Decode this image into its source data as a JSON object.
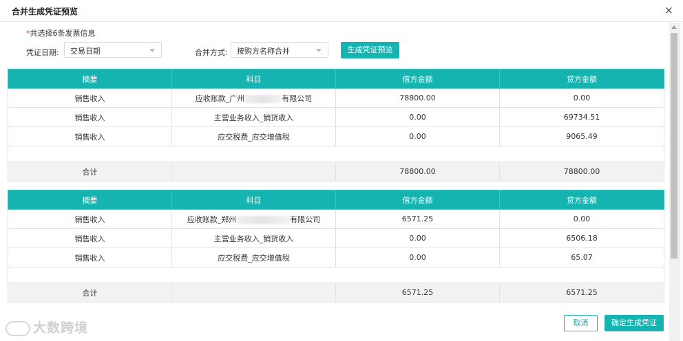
{
  "dialog": {
    "title": "合并生成凭证预览",
    "close_icon": "×"
  },
  "hint": {
    "star": "*",
    "text": "共选择6条发票信息"
  },
  "form": {
    "date_label": "凭证日期:",
    "date_value": "交易日期",
    "merge_label": "合并方式:",
    "merge_value": "按购方名称合并",
    "generate_button": "生成凭证预览"
  },
  "columns": [
    "摘要",
    "科目",
    "借方金额",
    "贷方金额"
  ],
  "vouchers": [
    {
      "rows": [
        {
          "summary": "销售收入",
          "subject_pre": "应收账款_广州",
          "subject_post": "有限公司",
          "debit": "78800.00",
          "credit": "0.00"
        },
        {
          "summary": "销售收入",
          "subject_pre": "主营业务收入_销货收入",
          "subject_post": "",
          "debit": "0.00",
          "credit": "69734.51"
        },
        {
          "summary": "销售收入",
          "subject_pre": "应交税费_应交增值税",
          "subject_post": "",
          "debit": "0.00",
          "credit": "9065.49"
        }
      ],
      "total": {
        "label": "合计",
        "debit": "78800.00",
        "credit": "78800.00"
      }
    },
    {
      "rows": [
        {
          "summary": "销售收入",
          "subject_pre": "应收账款_郑州",
          "subject_post": "有限公司",
          "debit": "6571.25",
          "credit": "0.00"
        },
        {
          "summary": "销售收入",
          "subject_pre": "主营业务收入_销货收入",
          "subject_post": "",
          "debit": "0.00",
          "credit": "6506.18"
        },
        {
          "summary": "销售收入",
          "subject_pre": "应交税费_应交增值税",
          "subject_post": "",
          "debit": "0.00",
          "credit": "65.07"
        }
      ],
      "total": {
        "label": "合计",
        "debit": "6571.25",
        "credit": "6571.25"
      }
    }
  ],
  "footer": {
    "cancel_button": "取消",
    "confirm_button": "确定生成凭证"
  },
  "watermark": {
    "text": "大数跨境"
  },
  "colors": {
    "accent": "#16b4b0",
    "required_star": "#e33333"
  }
}
